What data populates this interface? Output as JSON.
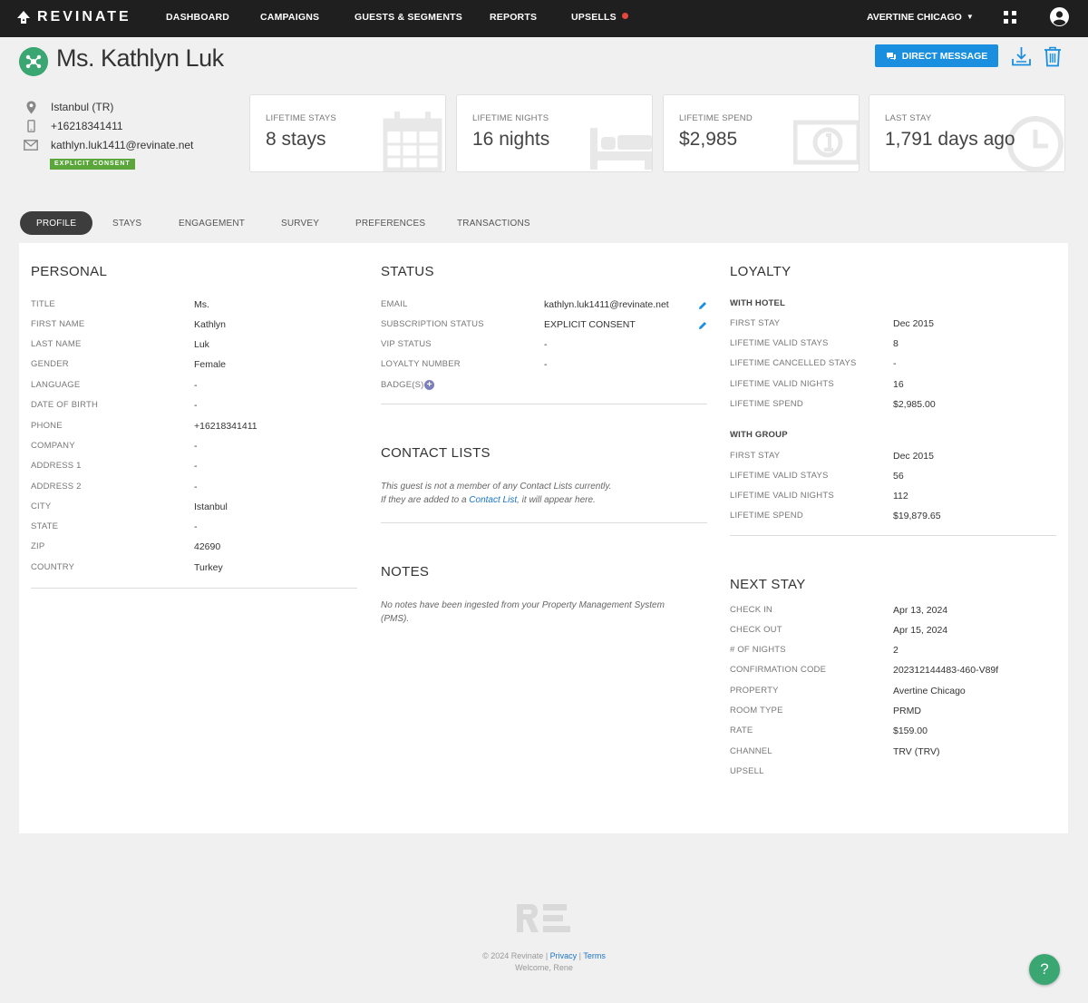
{
  "brand": {
    "name": "REVINATE"
  },
  "nav": {
    "items": [
      "DASHBOARD",
      "CAMPAIGNS",
      "GUESTS & SEGMENTS",
      "REPORTS",
      "UPSELLS"
    ],
    "upsells_dot_color": "#e5473c",
    "org": "AVERTINE CHICAGO"
  },
  "header": {
    "guest_name": "Ms. Kathlyn Luk",
    "direct_message": "DIRECT MESSAGE"
  },
  "contact": {
    "location": "Istanbul (TR)",
    "phone": "+16218341411",
    "email": "kathlyn.luk1411@revinate.net",
    "consent_badge": "EXPLICIT CONSENT"
  },
  "stats": [
    {
      "label": "LIFETIME STAYS",
      "value": "8 stays",
      "icon": "calendar-icon"
    },
    {
      "label": "LIFETIME NIGHTS",
      "value": "16 nights",
      "icon": "bed-icon"
    },
    {
      "label": "LIFETIME SPEND",
      "value": "$2,985",
      "icon": "money-icon"
    },
    {
      "label": "LAST STAY",
      "value": "1,791 days ago",
      "icon": "clock-icon"
    }
  ],
  "tabs": [
    "PROFILE",
    "STAYS",
    "ENGAGEMENT",
    "SURVEY",
    "PREFERENCES",
    "TRANSACTIONS"
  ],
  "personal": {
    "title": "PERSONAL",
    "rows": [
      {
        "label": "TITLE",
        "value": "Ms."
      },
      {
        "label": "FIRST NAME",
        "value": "Kathlyn"
      },
      {
        "label": "LAST NAME",
        "value": "Luk"
      },
      {
        "label": "GENDER",
        "value": "Female"
      },
      {
        "label": "LANGUAGE",
        "value": "-"
      },
      {
        "label": "DATE OF BIRTH",
        "value": "-"
      },
      {
        "label": "PHONE",
        "value": "+16218341411"
      },
      {
        "label": "COMPANY",
        "value": "-"
      },
      {
        "label": "ADDRESS 1",
        "value": "-"
      },
      {
        "label": "ADDRESS 2",
        "value": "-"
      },
      {
        "label": "CITY",
        "value": "Istanbul"
      },
      {
        "label": "STATE",
        "value": "-"
      },
      {
        "label": "ZIP",
        "value": "42690"
      },
      {
        "label": "COUNTRY",
        "value": "Turkey"
      }
    ]
  },
  "status": {
    "title": "STATUS",
    "rows": [
      {
        "label": "EMAIL",
        "value": "kathlyn.luk1411@revinate.net"
      },
      {
        "label": "SUBSCRIPTION STATUS",
        "value": "EXPLICIT CONSENT"
      },
      {
        "label": "VIP STATUS",
        "value": "-"
      },
      {
        "label": "LOYALTY NUMBER",
        "value": "-"
      },
      {
        "label": "BADGE(S)",
        "value": ""
      }
    ]
  },
  "contact_lists": {
    "title": "CONTACT LISTS",
    "note_line1": "This guest is not a member of any Contact Lists currently.",
    "note_line2_pre": "If they are added to a ",
    "note_link": "Contact List",
    "note_line2_post": ", it will appear here."
  },
  "notes": {
    "title": "NOTES",
    "note_line1": "No notes have been ingested from your Property Management System",
    "note_line2": "(PMS)."
  },
  "loyalty": {
    "title": "LOYALTY",
    "hotel_label": "WITH HOTEL",
    "hotel_rows": [
      {
        "label": "FIRST STAY",
        "value": "Dec 2015"
      },
      {
        "label": "LIFETIME VALID STAYS",
        "value": "8"
      },
      {
        "label": "LIFETIME CANCELLED STAYS",
        "value": "-"
      },
      {
        "label": "LIFETIME VALID NIGHTS",
        "value": "16"
      },
      {
        "label": "LIFETIME SPEND",
        "value": "$2,985.00"
      }
    ],
    "group_label": "WITH GROUP",
    "group_rows": [
      {
        "label": "FIRST STAY",
        "value": "Dec 2015"
      },
      {
        "label": "LIFETIME VALID STAYS",
        "value": "56"
      },
      {
        "label": "LIFETIME VALID NIGHTS",
        "value": "112"
      },
      {
        "label": "LIFETIME SPEND",
        "value": "$19,879.65"
      }
    ]
  },
  "next_stay": {
    "title": "NEXT STAY",
    "rows": [
      {
        "label": "CHECK IN",
        "value": "Apr 13, 2024"
      },
      {
        "label": "CHECK OUT",
        "value": "Apr 15, 2024"
      },
      {
        "label": "# OF NIGHTS",
        "value": "2"
      },
      {
        "label": "CONFIRMATION CODE",
        "value": "202312144483-460-V89f"
      },
      {
        "label": "PROPERTY",
        "value": "Avertine Chicago"
      },
      {
        "label": "ROOM TYPE",
        "value": "PRMD"
      },
      {
        "label": "RATE",
        "value": "$159.00"
      },
      {
        "label": "CHANNEL",
        "value": "TRV (TRV)"
      },
      {
        "label": "UPSELL",
        "value": ""
      }
    ]
  },
  "footer": {
    "copyright": "© 2024 Revinate",
    "privacy": "Privacy",
    "terms": "Terms",
    "welcome": "Welcome, Rene"
  },
  "help": {
    "label": "?"
  },
  "colors": {
    "accent_blue": "#1a8fe0",
    "brand_green": "#3aa672",
    "consent_green": "#5aa63a"
  }
}
